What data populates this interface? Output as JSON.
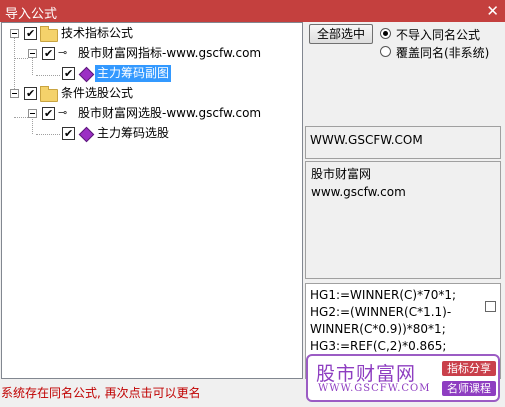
{
  "window": {
    "title": "导入公式",
    "close_glyph": "✕"
  },
  "tree": {
    "groups": [
      {
        "label": "技术指标公式",
        "source": {
          "label": "股市财富网指标-www.gscfw.com"
        },
        "formula": {
          "label": "主力筹码副图",
          "selected": true
        }
      },
      {
        "label": "条件选股公式",
        "source": {
          "label": "股市财富网选股-www.gscfw.com"
        },
        "formula": {
          "label": "主力筹码选股",
          "selected": false
        }
      }
    ]
  },
  "controls": {
    "select_all_label": "全部选中",
    "radio_no_import": "不导入同名公式",
    "radio_overwrite": "覆盖同名(非系统)"
  },
  "info": {
    "url": "WWW.GSCFW.COM",
    "desc_line1": "股市财富网",
    "desc_line2": "www.gscfw.com"
  },
  "code": {
    "line1": "HG1:=WINNER(C)*70*1;",
    "line2": "HG2:=(WINNER(C*1.1)-",
    "line3": "WINNER(C*0.9))*80*1;",
    "line4": "HG3:=REF(C,2)*0.865;"
  },
  "watermark": {
    "brand": "股市财富网",
    "domain": "WWW.GSCFW.COM",
    "tag1": "指标分享",
    "tag2": "名师课程"
  },
  "status": "系统存在同名公式, 再次点击可以更名",
  "colors": {
    "titlebar": "#c4403e",
    "selection": "#3399ff",
    "status": "#c00000",
    "watermark": "#8e3ec1"
  }
}
